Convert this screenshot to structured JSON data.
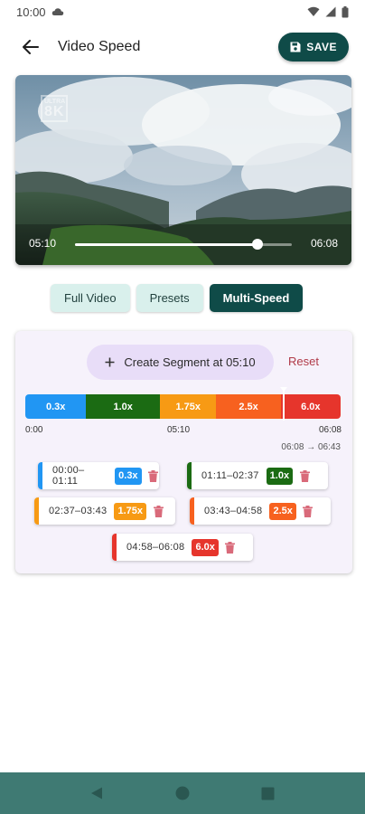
{
  "status_bar": {
    "time": "10:00"
  },
  "app_bar": {
    "title": "Video Speed",
    "save_label": "SAVE"
  },
  "video": {
    "watermark_line1": "ULTRA",
    "watermark_line2": "8K",
    "current_time": "05:10",
    "total_time": "06:08",
    "progress_fraction": 0.842
  },
  "tabs": [
    {
      "label": "Full Video",
      "active": false
    },
    {
      "label": "Presets",
      "active": false
    },
    {
      "label": "Multi-Speed",
      "active": true
    }
  ],
  "multi_speed": {
    "create_label": "Create Segment at 05:10",
    "reset_label": "Reset",
    "timeline_start": "0:00",
    "timeline_mid": "05:10",
    "timeline_end": "06:08",
    "duration_change": "06:08 → 06:43",
    "segments": [
      {
        "range": "00:00–01:11",
        "speed": "0.3x",
        "color": "#2196f3",
        "fraction": 0.193
      },
      {
        "range": "01:11–02:37",
        "speed": "1.0x",
        "color": "#1b6b13",
        "fraction": 0.234
      },
      {
        "range": "02:37–03:43",
        "speed": "1.75x",
        "color": "#f79a14",
        "fraction": 0.179
      },
      {
        "range": "03:43–04:58",
        "speed": "2.5x",
        "color": "#f7611f",
        "fraction": 0.204
      },
      {
        "range": "04:58–06:08",
        "speed": "6.0x",
        "color": "#e6352c",
        "fraction": 0.19
      }
    ]
  },
  "colors": {
    "primary": "#0f4b48",
    "tab_inactive": "#d9f0ec",
    "card_bg": "#f6f2fb",
    "create_bg": "#e8ddf8",
    "reset": "#b03a48",
    "delete_icon": "#d96a7a",
    "nav_bar": "#3f7a73"
  },
  "icons": {
    "back": "arrow-left-icon",
    "save": "floppy-disk-icon",
    "add": "plus-icon",
    "delete": "trash-icon",
    "nav_back": "triangle-back-icon",
    "nav_home": "circle-home-icon",
    "nav_recents": "square-recents-icon"
  }
}
